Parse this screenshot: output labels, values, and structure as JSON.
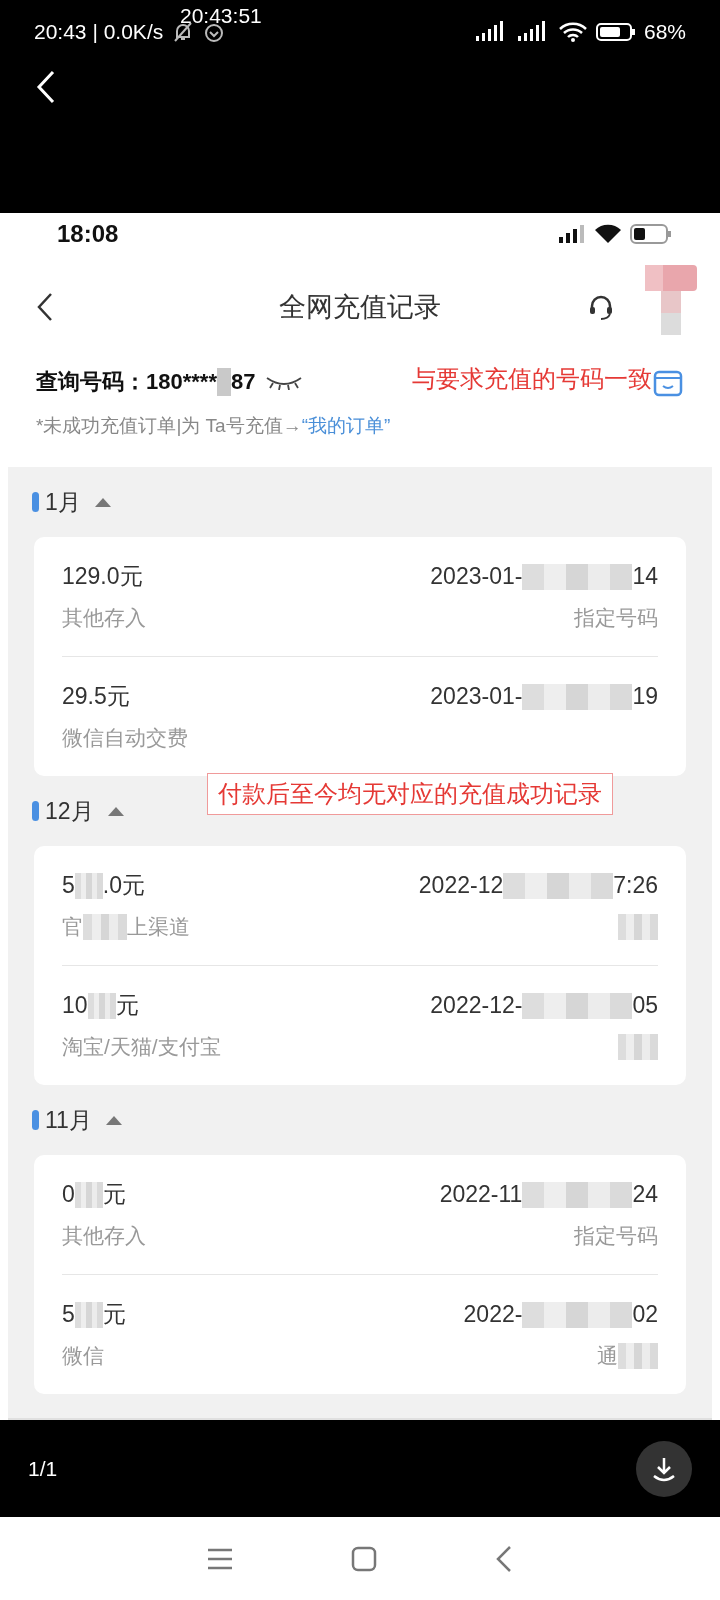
{
  "viewer_status": {
    "time": "20:43 | 0.0K/s",
    "overlay_clock": "20:43:51",
    "battery": "68%"
  },
  "inner_status": {
    "time": "18:08"
  },
  "nav": {
    "title": "全网充值记录"
  },
  "query": {
    "label": "查询号码：",
    "number_head": "180****",
    "number_tail": "87"
  },
  "note": {
    "text": "*未成功充值订单|为 Ta号充值→",
    "link": "“我的订单”"
  },
  "annotations": [
    "与要求充值的号码一致",
    "付款后至今均无对应的充值成功记录"
  ],
  "groups": [
    {
      "month": "1月",
      "expanded": true,
      "records": [
        {
          "amount": [
            {
              "kind": "text",
              "text": "129.0元"
            }
          ],
          "date": [
            {
              "kind": "text",
              "text": "2023-01-"
            },
            {
              "kind": "blur"
            },
            {
              "kind": "text",
              "text": "14"
            }
          ],
          "source": [
            {
              "kind": "text",
              "text": "其他存入"
            }
          ],
          "type": [
            {
              "kind": "text",
              "text": "指定号码"
            }
          ]
        },
        {
          "amount": [
            {
              "kind": "text",
              "text": "29.5元"
            }
          ],
          "date": [
            {
              "kind": "text",
              "text": "2023-01-"
            },
            {
              "kind": "blur"
            },
            {
              "kind": "text",
              "text": "19"
            }
          ],
          "source": [
            {
              "kind": "text",
              "text": "微信自动交费"
            }
          ]
        }
      ]
    },
    {
      "month": "12月",
      "expanded": true,
      "records": [
        {
          "amount": [
            {
              "kind": "text",
              "text": "5"
            },
            {
              "kind": "blur"
            },
            {
              "kind": "text",
              "text": ".0元"
            }
          ],
          "date": [
            {
              "kind": "text",
              "text": "2022-12"
            },
            {
              "kind": "blur"
            },
            {
              "kind": "text",
              "text": "7:26"
            }
          ],
          "source": [
            {
              "kind": "text",
              "text": "官"
            },
            {
              "kind": "blur"
            },
            {
              "kind": "text",
              "text": "上渠道"
            }
          ],
          "type": [
            {
              "kind": "blur"
            }
          ]
        },
        {
          "amount": [
            {
              "kind": "text",
              "text": "10"
            },
            {
              "kind": "blur"
            },
            {
              "kind": "text",
              "text": "元"
            }
          ],
          "date": [
            {
              "kind": "text",
              "text": "2022-12-"
            },
            {
              "kind": "blur"
            },
            {
              "kind": "text",
              "text": "05"
            }
          ],
          "source": [
            {
              "kind": "text",
              "text": "淘宝/天猫/支付宝"
            }
          ],
          "type": [
            {
              "kind": "blur"
            }
          ]
        }
      ]
    },
    {
      "month": "11月",
      "expanded": true,
      "records": [
        {
          "amount": [
            {
              "kind": "text",
              "text": "0"
            },
            {
              "kind": "blur"
            },
            {
              "kind": "text",
              "text": "元"
            }
          ],
          "date": [
            {
              "kind": "text",
              "text": "2022-11"
            },
            {
              "kind": "blur"
            },
            {
              "kind": "text",
              "text": "24"
            }
          ],
          "source": [
            {
              "kind": "text",
              "text": "其他存入"
            }
          ],
          "type": [
            {
              "kind": "text",
              "text": "指定号码"
            }
          ]
        },
        {
          "amount": [
            {
              "kind": "text",
              "text": "5"
            },
            {
              "kind": "blur"
            },
            {
              "kind": "text",
              "text": "元"
            }
          ],
          "date": [
            {
              "kind": "text",
              "text": "2022-"
            },
            {
              "kind": "blur"
            },
            {
              "kind": "text",
              "text": "02"
            }
          ],
          "source": [
            {
              "kind": "text",
              "text": "微信"
            }
          ],
          "type": [
            {
              "kind": "text",
              "text": "通"
            },
            {
              "kind": "blur"
            }
          ]
        }
      ]
    }
  ],
  "viewer_footer": {
    "counter": "1/1"
  }
}
